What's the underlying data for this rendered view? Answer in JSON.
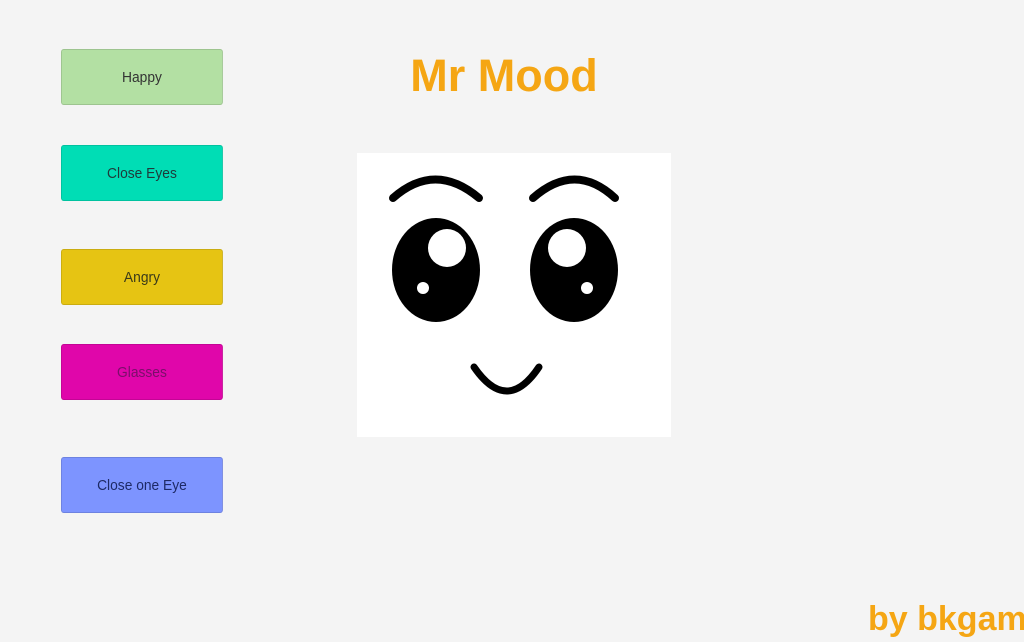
{
  "app": {
    "title": "Mr Mood",
    "credit": "by bkgame",
    "accent_color": "#f5a614"
  },
  "buttons": [
    {
      "label": "Happy",
      "color": "#b3e0a3",
      "text_color": "#333333"
    },
    {
      "label": "Close Eyes",
      "color": "#00ddb5",
      "text_color": "#1f3a3a"
    },
    {
      "label": "Angry",
      "color": "#e6c413",
      "text_color": "#3a3a1a"
    },
    {
      "label": "Glasses",
      "color": "#e006aa",
      "text_color": "#7a0f6a"
    },
    {
      "label": "Close one Eye",
      "color": "#7d94ff",
      "text_color": "#1e2a66"
    }
  ],
  "face": {
    "mood": "happy",
    "icon": "smiling-face-icon"
  }
}
